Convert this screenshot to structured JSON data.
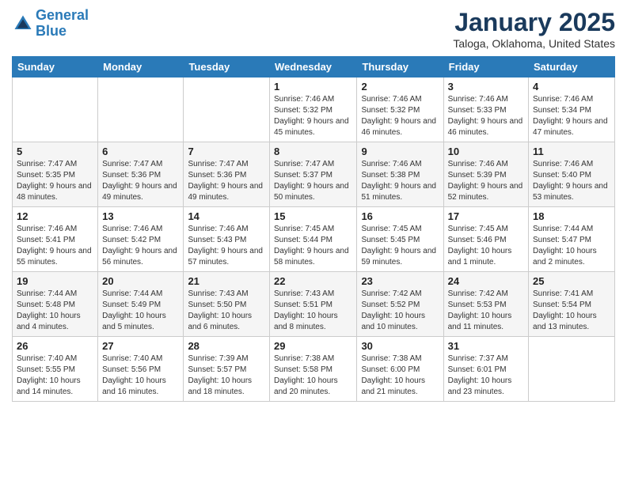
{
  "header": {
    "logo_line1": "General",
    "logo_line2": "Blue",
    "month": "January 2025",
    "location": "Taloga, Oklahoma, United States"
  },
  "weekdays": [
    "Sunday",
    "Monday",
    "Tuesday",
    "Wednesday",
    "Thursday",
    "Friday",
    "Saturday"
  ],
  "weeks": [
    [
      {
        "day": "",
        "info": ""
      },
      {
        "day": "",
        "info": ""
      },
      {
        "day": "",
        "info": ""
      },
      {
        "day": "1",
        "info": "Sunrise: 7:46 AM\nSunset: 5:32 PM\nDaylight: 9 hours and 45 minutes."
      },
      {
        "day": "2",
        "info": "Sunrise: 7:46 AM\nSunset: 5:32 PM\nDaylight: 9 hours and 46 minutes."
      },
      {
        "day": "3",
        "info": "Sunrise: 7:46 AM\nSunset: 5:33 PM\nDaylight: 9 hours and 46 minutes."
      },
      {
        "day": "4",
        "info": "Sunrise: 7:46 AM\nSunset: 5:34 PM\nDaylight: 9 hours and 47 minutes."
      }
    ],
    [
      {
        "day": "5",
        "info": "Sunrise: 7:47 AM\nSunset: 5:35 PM\nDaylight: 9 hours and 48 minutes."
      },
      {
        "day": "6",
        "info": "Sunrise: 7:47 AM\nSunset: 5:36 PM\nDaylight: 9 hours and 49 minutes."
      },
      {
        "day": "7",
        "info": "Sunrise: 7:47 AM\nSunset: 5:36 PM\nDaylight: 9 hours and 49 minutes."
      },
      {
        "day": "8",
        "info": "Sunrise: 7:47 AM\nSunset: 5:37 PM\nDaylight: 9 hours and 50 minutes."
      },
      {
        "day": "9",
        "info": "Sunrise: 7:46 AM\nSunset: 5:38 PM\nDaylight: 9 hours and 51 minutes."
      },
      {
        "day": "10",
        "info": "Sunrise: 7:46 AM\nSunset: 5:39 PM\nDaylight: 9 hours and 52 minutes."
      },
      {
        "day": "11",
        "info": "Sunrise: 7:46 AM\nSunset: 5:40 PM\nDaylight: 9 hours and 53 minutes."
      }
    ],
    [
      {
        "day": "12",
        "info": "Sunrise: 7:46 AM\nSunset: 5:41 PM\nDaylight: 9 hours and 55 minutes."
      },
      {
        "day": "13",
        "info": "Sunrise: 7:46 AM\nSunset: 5:42 PM\nDaylight: 9 hours and 56 minutes."
      },
      {
        "day": "14",
        "info": "Sunrise: 7:46 AM\nSunset: 5:43 PM\nDaylight: 9 hours and 57 minutes."
      },
      {
        "day": "15",
        "info": "Sunrise: 7:45 AM\nSunset: 5:44 PM\nDaylight: 9 hours and 58 minutes."
      },
      {
        "day": "16",
        "info": "Sunrise: 7:45 AM\nSunset: 5:45 PM\nDaylight: 9 hours and 59 minutes."
      },
      {
        "day": "17",
        "info": "Sunrise: 7:45 AM\nSunset: 5:46 PM\nDaylight: 10 hours and 1 minute."
      },
      {
        "day": "18",
        "info": "Sunrise: 7:44 AM\nSunset: 5:47 PM\nDaylight: 10 hours and 2 minutes."
      }
    ],
    [
      {
        "day": "19",
        "info": "Sunrise: 7:44 AM\nSunset: 5:48 PM\nDaylight: 10 hours and 4 minutes."
      },
      {
        "day": "20",
        "info": "Sunrise: 7:44 AM\nSunset: 5:49 PM\nDaylight: 10 hours and 5 minutes."
      },
      {
        "day": "21",
        "info": "Sunrise: 7:43 AM\nSunset: 5:50 PM\nDaylight: 10 hours and 6 minutes."
      },
      {
        "day": "22",
        "info": "Sunrise: 7:43 AM\nSunset: 5:51 PM\nDaylight: 10 hours and 8 minutes."
      },
      {
        "day": "23",
        "info": "Sunrise: 7:42 AM\nSunset: 5:52 PM\nDaylight: 10 hours and 10 minutes."
      },
      {
        "day": "24",
        "info": "Sunrise: 7:42 AM\nSunset: 5:53 PM\nDaylight: 10 hours and 11 minutes."
      },
      {
        "day": "25",
        "info": "Sunrise: 7:41 AM\nSunset: 5:54 PM\nDaylight: 10 hours and 13 minutes."
      }
    ],
    [
      {
        "day": "26",
        "info": "Sunrise: 7:40 AM\nSunset: 5:55 PM\nDaylight: 10 hours and 14 minutes."
      },
      {
        "day": "27",
        "info": "Sunrise: 7:40 AM\nSunset: 5:56 PM\nDaylight: 10 hours and 16 minutes."
      },
      {
        "day": "28",
        "info": "Sunrise: 7:39 AM\nSunset: 5:57 PM\nDaylight: 10 hours and 18 minutes."
      },
      {
        "day": "29",
        "info": "Sunrise: 7:38 AM\nSunset: 5:58 PM\nDaylight: 10 hours and 20 minutes."
      },
      {
        "day": "30",
        "info": "Sunrise: 7:38 AM\nSunset: 6:00 PM\nDaylight: 10 hours and 21 minutes."
      },
      {
        "day": "31",
        "info": "Sunrise: 7:37 AM\nSunset: 6:01 PM\nDaylight: 10 hours and 23 minutes."
      },
      {
        "day": "",
        "info": ""
      }
    ]
  ]
}
